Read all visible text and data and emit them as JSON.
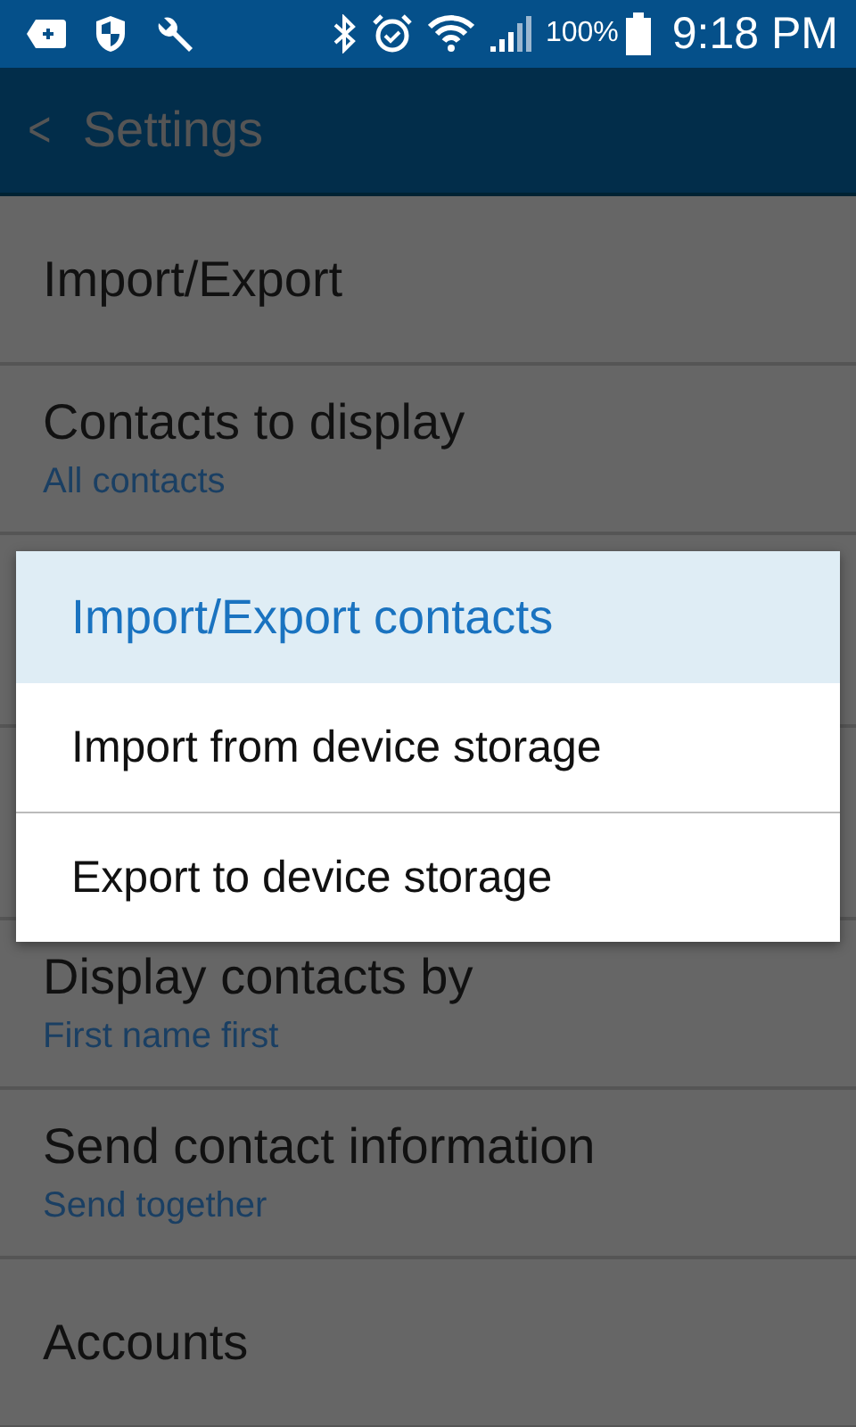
{
  "status_bar": {
    "battery": "100%",
    "time": "9:18 PM"
  },
  "app_bar": {
    "back": "<",
    "title": "Settings"
  },
  "settings": [
    {
      "kind": "item",
      "title": "Import/Export"
    },
    {
      "kind": "item",
      "title": "Contacts to display",
      "summary": "All contacts"
    },
    {
      "kind": "hidden"
    },
    {
      "kind": "hidden"
    },
    {
      "kind": "item",
      "title": "Display contacts by",
      "summary": "First name first"
    },
    {
      "kind": "item",
      "title": "Send contact information",
      "summary": "Send together"
    },
    {
      "kind": "item",
      "title": "Accounts"
    }
  ],
  "dialog": {
    "title": "Import/Export contacts",
    "options": [
      "Import from device storage",
      "Export to device storage"
    ]
  }
}
